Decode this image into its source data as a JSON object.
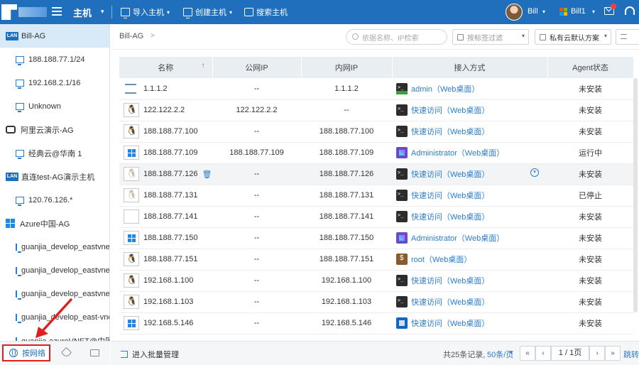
{
  "topbar": {
    "app_title": "主机",
    "actions": [
      {
        "label": "导入主机",
        "icon": "monitor-icon"
      },
      {
        "label": "创建主机",
        "icon": "monitor-icon"
      },
      {
        "label": "搜索主机",
        "icon": "search-icon"
      }
    ],
    "user_name": "Bill",
    "tenant_name": "Bill1"
  },
  "sidebar": {
    "items": [
      {
        "label": "Bill-AG",
        "icon": "lan-badge",
        "active": true
      },
      {
        "label": "188.188.77.1/24",
        "icon": "host-icon"
      },
      {
        "label": "192.168.2.1/16",
        "icon": "host-icon"
      },
      {
        "label": "Unknown",
        "icon": "host-icon"
      },
      {
        "label": "阿里云演示-AG",
        "icon": "aliyun-icon"
      },
      {
        "label": "经典云@华南 1",
        "icon": "host-icon"
      },
      {
        "label": "直连test-AG演示主机",
        "icon": "lan-badge"
      },
      {
        "label": "120.76.126.*",
        "icon": "host-icon"
      },
      {
        "label": "Azure中国-AG",
        "icon": "windows-icon"
      },
      {
        "label": "guanjia_develop_eastvnet",
        "icon": "host-icon"
      },
      {
        "label": "guanjia_develop_eastvnet",
        "icon": "host-icon"
      },
      {
        "label": "guanjia_develop_eastvnet",
        "icon": "host-icon"
      },
      {
        "label": "guanjia_develop_east-vnet",
        "icon": "host-icon"
      },
      {
        "label": "guanjia-azureVNET@中国",
        "icon": "host-icon"
      }
    ],
    "lan_badge_text": "LAN",
    "footer": {
      "network_tab": "按网络"
    }
  },
  "main": {
    "breadcrumb": "Bill-AG",
    "breadcrumb_sep": ">",
    "search_placeholder": "依据名称、IP检索",
    "tag_filter_placeholder": "按标签过滤",
    "scheme_select": "私有云默认方案",
    "table": {
      "columns": [
        "名称",
        "公网IP",
        "内网IP",
        "接入方式",
        "Agent状态"
      ],
      "rows": [
        {
          "name": "1.1.1.2",
          "os": "net",
          "public_ip": "--",
          "private_ip": "1.1.1.2",
          "access_icon": "term-green",
          "access": "admin（Web桌面）",
          "status": "未安装"
        },
        {
          "name": "122.122.2.2",
          "os": "linux",
          "public_ip": "122.122.2.2",
          "private_ip": "--",
          "access_icon": "term",
          "access": "快速访问（Web桌面）",
          "status": "未安装"
        },
        {
          "name": "188.188.77.100",
          "os": "linux",
          "public_ip": "--",
          "private_ip": "188.188.77.100",
          "access_icon": "term",
          "access": "快速访问（Web桌面）",
          "status": "未安装"
        },
        {
          "name": "188.188.77.109",
          "os": "windows",
          "public_ip": "188.188.77.109",
          "private_ip": "188.188.77.109",
          "access_icon": "rdp",
          "access": "Administrator（Web桌面）",
          "status": "运行中"
        },
        {
          "name": "188.188.77.126",
          "os": "linux-dim",
          "public_ip": "--",
          "private_ip": "188.188.77.126",
          "access_icon": "term",
          "access": "快速访问（Web桌面）",
          "status": "未安装",
          "hover": true
        },
        {
          "name": "188.188.77.131",
          "os": "linux-dim",
          "public_ip": "--",
          "private_ip": "188.188.77.131",
          "access_icon": "term",
          "access": "快速访问（Web桌面）",
          "status": "已停止"
        },
        {
          "name": "188.188.77.141",
          "os": "blank",
          "public_ip": "--",
          "private_ip": "188.188.77.141",
          "access_icon": "term",
          "access": "快速访问（Web桌面）",
          "status": "未安装"
        },
        {
          "name": "188.188.77.150",
          "os": "windows",
          "public_ip": "--",
          "private_ip": "188.188.77.150",
          "access_icon": "rdp",
          "access": "Administrator（Web桌面）",
          "status": "未安装"
        },
        {
          "name": "188.188.77.151",
          "os": "linux",
          "public_ip": "--",
          "private_ip": "188.188.77.151",
          "access_icon": "root",
          "access": "root（Web桌面）",
          "status": "未安装"
        },
        {
          "name": "192.168.1.100",
          "os": "linux",
          "public_ip": "--",
          "private_ip": "192.168.1.100",
          "access_icon": "term",
          "access": "快速访问（Web桌面）",
          "status": "未安装"
        },
        {
          "name": "192.168.1.103",
          "os": "linux",
          "public_ip": "--",
          "private_ip": "192.168.1.103",
          "access_icon": "term",
          "access": "快速访问（Web桌面）",
          "status": "未安装"
        },
        {
          "name": "192.168.5.146",
          "os": "windows",
          "public_ip": "--",
          "private_ip": "192.168.5.146",
          "access_icon": "blue",
          "access": "快速访问（Web桌面）",
          "status": "未安装"
        }
      ]
    }
  },
  "footer": {
    "batch_label": "进入批量管理",
    "total": "共25条记录,",
    "per_page": "50条/页",
    "page_indicator": "1 / 1页",
    "first": "«",
    "prev": "‹",
    "next": "›",
    "last": "»",
    "jump": "跳转"
  },
  "colors": {
    "brand": "#1f6fbd",
    "link": "#2a7dcc",
    "highlight_box": "#e02020"
  }
}
